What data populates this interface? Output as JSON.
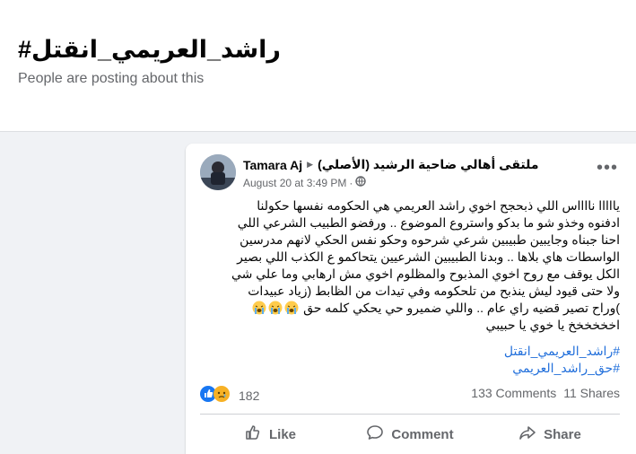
{
  "page": {
    "hashtag_title": "#راشد_العريمي_انقتل",
    "subtitle": "People are posting about this"
  },
  "post": {
    "author": "Tamara Aj",
    "group": "ملتقى أهالي ضاحية الرشيد (الأصلي)",
    "timestamp": "August 20 at 3:49 PM",
    "body_lines": [
      "يااااا نااااس اللي ذبحجح اخوي راشد العريمي هي الحكومه نفسها حكولنا",
      "ادفنوه وخذو شو ما بدكو واستروع الموضوع .. ورفضو الطبيب الشرعي اللي",
      "احنا جبناه وجايبين طبيبين شرعي شرحوه وحكو نفس الحكي لانهم مدرسين",
      "الواسطات هاي بلاها ..  وبدنا الطبيبين الشرعيين يتحاكمو ع الكذب اللي بصير",
      "الكل يوقف مع روح اخوي المذبوح والمظلوم اخوي مش ارهابي وما علي شي",
      "ولا حتى قيود ليش ينذبح من تلحكومه وفي تيدات من الظابط (زياد عبيدات",
      ")وراح تصير قضيه راي عام .. واللي ضميرو حي يحكي كلمه حق",
      "اخخخخخخ يا خوي يا حبيبي"
    ],
    "hashtags": [
      "#راشد_العريمي_انقتل",
      "#حق_راشد_العريمي"
    ],
    "reaction_count": "182",
    "comments": "133 Comments",
    "shares": "11 Shares",
    "actions": {
      "like": "Like",
      "comment": "Comment",
      "share": "Share"
    }
  },
  "colors": {
    "link": "#216fdb",
    "muted": "#65676b",
    "like_blue": "#1877f2",
    "sad_yellow": "#f7b125"
  },
  "icons": [
    "avatar",
    "play-arrow-icon",
    "globe-icon",
    "more-icon",
    "crying-emoji-icon",
    "like-reaction-icon",
    "sad-reaction-icon",
    "like-icon",
    "comment-icon",
    "share-icon"
  ]
}
